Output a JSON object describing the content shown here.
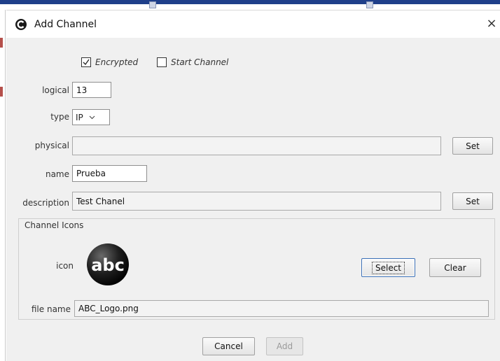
{
  "window": {
    "title": "Add Channel",
    "close_glyph": "×"
  },
  "options": {
    "encrypted_label": "Encrypted",
    "encrypted_checked": true,
    "start_channel_label": "Start Channel",
    "start_channel_checked": false
  },
  "form": {
    "logical_label": "logical",
    "logical_value": "13",
    "type_label": "type",
    "type_value": "IP",
    "physical_label": "physical",
    "physical_value": "",
    "physical_set_label": "Set",
    "name_label": "name",
    "name_value": "Prueba",
    "description_label": "description",
    "description_value": "Test Chanel",
    "description_set_label": "Set"
  },
  "icons_group": {
    "title": "Channel Icons",
    "icon_label": "icon",
    "logo_text": "abc",
    "select_label": "Select",
    "clear_label": "Clear",
    "file_name_label": "file name",
    "file_name_value": "ABC_Logo.png"
  },
  "footer": {
    "cancel_label": "Cancel",
    "add_label": "Add",
    "add_enabled": false
  },
  "colors": {
    "dialog_bg": "#f0f0f0",
    "focus_border": "#3b6fb6"
  },
  "icons": [
    "app-c-icon",
    "close-icon",
    "checkmark-icon",
    "chevron-down-icon",
    "abc-logo-icon"
  ]
}
